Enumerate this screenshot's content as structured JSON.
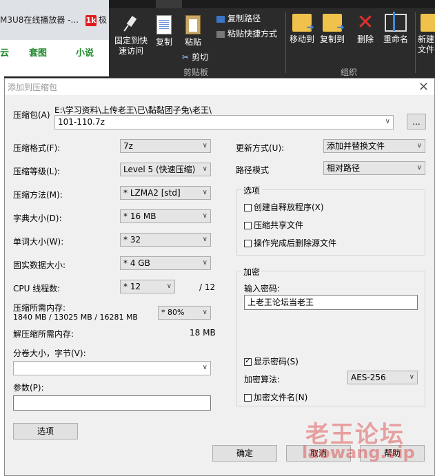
{
  "browser": {
    "tab1": "M3U8在线播放器 -...",
    "tab2_logo": "1k",
    "tab2": "极",
    "nav_left": "云",
    "nav_mid": "套图",
    "nav_right": "小说"
  },
  "ribbon": {
    "pin_label_1": "固定到快",
    "pin_label_2": "速访问",
    "copy": "复制",
    "paste": "粘贴",
    "copy_path": "复制路径",
    "paste_shortcut": "粘贴快捷方式",
    "cut": "剪切",
    "clipboard_group": "剪贴板",
    "move_to": "移动到",
    "copy_to": "复制到",
    "delete": "删除",
    "rename": "重命名",
    "organize_group": "组织",
    "new_1": "新建",
    "new_2": "文件"
  },
  "dialog": {
    "title": "添加到压缩包",
    "close": "×",
    "archive_label": "压缩包(A)",
    "archive_path": "E:\\学习资料\\上传老王\\已\\黏黏团子兔\\老王\\",
    "archive_name": "101-110.7z",
    "browse": "...",
    "format_label": "压缩格式(F):",
    "format_value": "7z",
    "level_label": "压缩等级(L):",
    "level_value": "Level 5 (快速压缩)",
    "method_label": "压缩方法(M):",
    "method_value": "*  LZMA2 [std]",
    "dict_label": "字典大小(D):",
    "dict_value": "*  16 MB",
    "word_label": "单词大小(W):",
    "word_value": "*  32",
    "solid_label": "固实数据大小:",
    "solid_value": "*  4 GB",
    "cpu_label": "CPU 线程数:",
    "cpu_value": "*  12",
    "cpu_total": "/ 12",
    "mem_label": "压缩所需内存:",
    "mem_detail": "1840 MB / 13025 MB / 16281 MB",
    "mem_pct": "* 80%",
    "decomp_label": "解压缩所需内存:",
    "decomp_value": "18 MB",
    "split_label": "分卷大小，字节(V):",
    "split_value": "",
    "params_label": "参数(P):",
    "params_value": "",
    "options_btn": "选项",
    "update_label": "更新方式(U):",
    "update_value": "添加并替换文件",
    "path_label": "路径模式",
    "path_value": "相对路径",
    "options_group": "选项",
    "sfx": "创建自释放程序(X)",
    "shared": "压缩共享文件",
    "delete_after": "操作完成后删除源文件",
    "enc_group": "加密",
    "pwd_label": "输入密码:",
    "pwd_value": "上老王论坛当老王",
    "show_pwd": "显示密码(S)",
    "enc_method_label": "加密算法:",
    "enc_method_value": "AES-256",
    "enc_names": "加密文件名(N)",
    "ok": "确定",
    "cancel": "取消",
    "help": "帮助"
  },
  "watermark": {
    "line1": "老王论坛",
    "line2": "laowang.vip"
  }
}
